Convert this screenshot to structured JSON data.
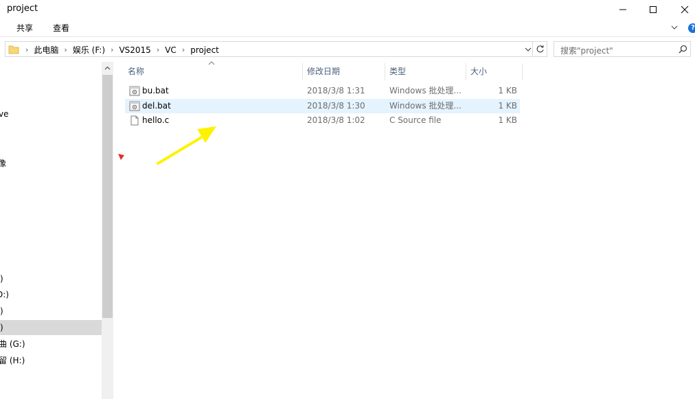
{
  "window": {
    "title": "project"
  },
  "ribbon": {
    "tabs": [
      "共享",
      "查看"
    ]
  },
  "address": {
    "crumbs": [
      "此电脑",
      "娱乐 (F:)",
      "VS2015",
      "VC",
      "project"
    ]
  },
  "search": {
    "placeholder": "搜索\"project\""
  },
  "nav": {
    "items": [
      {
        "label": "ve"
      },
      {
        "label": "像"
      },
      {
        "label": ":)"
      },
      {
        "label": "D:)"
      },
      {
        "label": ":)"
      },
      {
        "label": ":)"
      },
      {
        "label": "曲 (G:)"
      },
      {
        "label": "留 (H:)"
      }
    ]
  },
  "columns": {
    "name": "名称",
    "date": "修改日期",
    "type": "类型",
    "size": "大小"
  },
  "files": [
    {
      "name": "bu.bat",
      "date": "2018/3/8 1:31",
      "type": "Windows 批处理...",
      "size": "1 KB",
      "icon": "batch-file-icon"
    },
    {
      "name": "del.bat",
      "date": "2018/3/8 1:30",
      "type": "Windows 批处理...",
      "size": "1 KB",
      "icon": "batch-file-icon"
    },
    {
      "name": "hello.c",
      "date": "2018/3/8 1:02",
      "type": "C Source file",
      "size": "1 KB",
      "icon": "document-file-icon"
    }
  ],
  "colors": {
    "hover_row": "#e5f3ff",
    "selected_nav": "#d9d9d9",
    "header_text": "#4c607a",
    "annotation_arrow": "#fff200",
    "red_mark": "#e0302a"
  }
}
